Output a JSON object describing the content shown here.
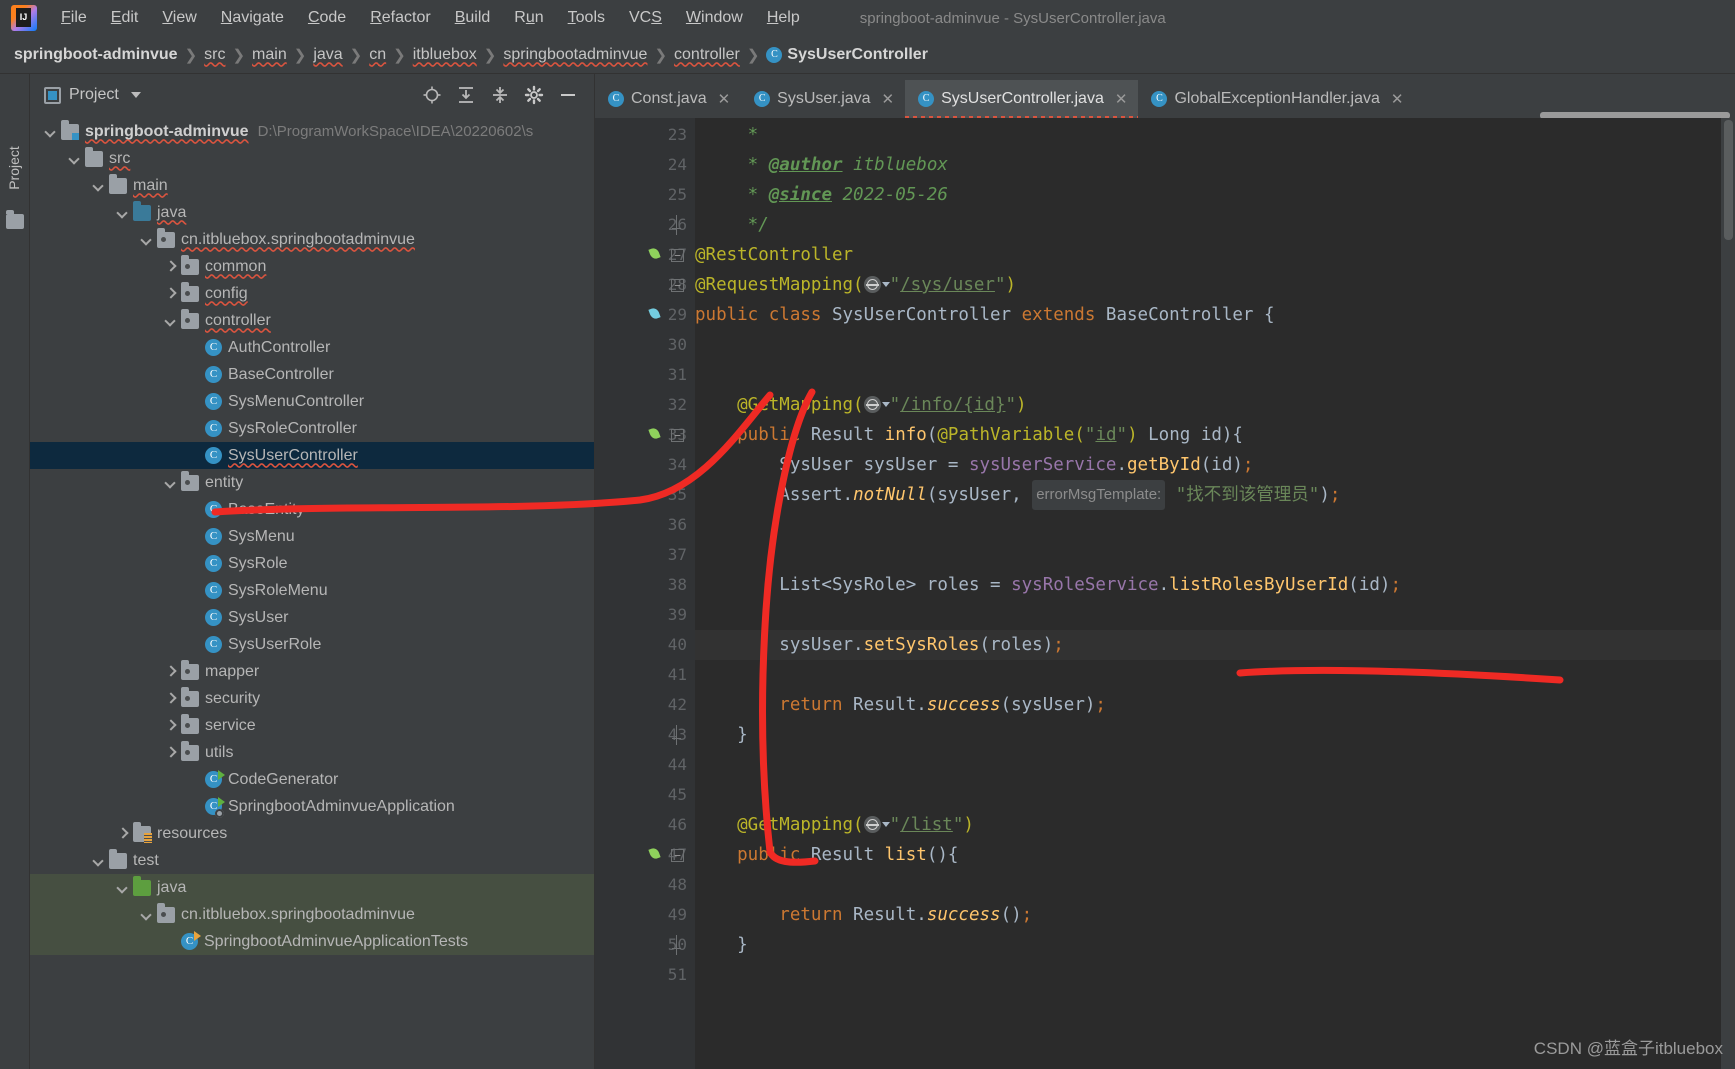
{
  "window": {
    "title": "springboot-adminvue - SysUserController.java",
    "logo_text": "IJ"
  },
  "menu": {
    "items": [
      {
        "mnemonic": "F",
        "rest": "ile"
      },
      {
        "mnemonic": "E",
        "rest": "dit"
      },
      {
        "mnemonic": "V",
        "rest": "iew"
      },
      {
        "mnemonic": "N",
        "rest": "avigate"
      },
      {
        "mnemonic": "C",
        "rest": "ode"
      },
      {
        "mnemonic": "R",
        "rest": "efactor"
      },
      {
        "mnemonic": "B",
        "rest": "uild"
      },
      {
        "mnemonic": "R",
        "rest": "un",
        "prefix": "R",
        "mid": "u",
        "tail": "n"
      },
      {
        "mnemonic": "T",
        "rest": "ools"
      },
      {
        "mnemonic": "S",
        "rest": "VCS"
      },
      {
        "mnemonic": "W",
        "rest": "indow"
      },
      {
        "mnemonic": "H",
        "rest": "elp"
      }
    ],
    "labels": [
      "File",
      "Edit",
      "View",
      "Navigate",
      "Code",
      "Refactor",
      "Build",
      "Run",
      "Tools",
      "VCS",
      "Window",
      "Help"
    ]
  },
  "breadcrumb": {
    "items": [
      "springboot-adminvue",
      "src",
      "main",
      "java",
      "cn",
      "itbluebox",
      "springbootadminvue",
      "controller"
    ],
    "last_class": "SysUserController",
    "class_icon": "C"
  },
  "toolwindow": {
    "vertical_tab": "Project",
    "panel_title": "Project",
    "actions": [
      "locate-icon",
      "expand-all-icon",
      "collapse-all-icon",
      "settings-icon",
      "hide-icon"
    ]
  },
  "tree": {
    "items": [
      {
        "label": "springboot-adminvue",
        "path": "D:\\ProgramWorkSpace\\IDEA\\20220602\\s",
        "indent": 0,
        "arrow": "down",
        "icon": "module",
        "bold": true,
        "squiggle": true,
        "selected": false
      },
      {
        "label": "src",
        "indent": 1,
        "arrow": "down",
        "icon": "folder",
        "squiggle": true
      },
      {
        "label": "main",
        "indent": 2,
        "arrow": "down",
        "icon": "folder",
        "squiggle": true
      },
      {
        "label": "java",
        "indent": 3,
        "arrow": "down",
        "icon": "folder-blue",
        "squiggle": true
      },
      {
        "label": "cn.itbluebox.springbootadminvue",
        "indent": 4,
        "arrow": "down",
        "icon": "package",
        "squiggle": true
      },
      {
        "label": "common",
        "indent": 5,
        "arrow": "right",
        "icon": "package",
        "squiggle": true
      },
      {
        "label": "config",
        "indent": 5,
        "arrow": "right",
        "icon": "package",
        "squiggle": true
      },
      {
        "label": "controller",
        "indent": 5,
        "arrow": "down",
        "icon": "package",
        "squiggle": true
      },
      {
        "label": "AuthController",
        "indent": 6,
        "arrow": "none",
        "icon": "class"
      },
      {
        "label": "BaseController",
        "indent": 6,
        "arrow": "none",
        "icon": "class"
      },
      {
        "label": "SysMenuController",
        "indent": 6,
        "arrow": "none",
        "icon": "class"
      },
      {
        "label": "SysRoleController",
        "indent": 6,
        "arrow": "none",
        "icon": "class"
      },
      {
        "label": "SysUserController",
        "indent": 6,
        "arrow": "none",
        "icon": "class",
        "selected": true,
        "squiggle": true
      },
      {
        "label": "entity",
        "indent": 5,
        "arrow": "down",
        "icon": "package"
      },
      {
        "label": "BaseEntity",
        "indent": 6,
        "arrow": "none",
        "icon": "class"
      },
      {
        "label": "SysMenu",
        "indent": 6,
        "arrow": "none",
        "icon": "class"
      },
      {
        "label": "SysRole",
        "indent": 6,
        "arrow": "none",
        "icon": "class"
      },
      {
        "label": "SysRoleMenu",
        "indent": 6,
        "arrow": "none",
        "icon": "class"
      },
      {
        "label": "SysUser",
        "indent": 6,
        "arrow": "none",
        "icon": "class"
      },
      {
        "label": "SysUserRole",
        "indent": 6,
        "arrow": "none",
        "icon": "class"
      },
      {
        "label": "mapper",
        "indent": 5,
        "arrow": "right",
        "icon": "package"
      },
      {
        "label": "security",
        "indent": 5,
        "arrow": "right",
        "icon": "package"
      },
      {
        "label": "service",
        "indent": 5,
        "arrow": "right",
        "icon": "package"
      },
      {
        "label": "utils",
        "indent": 5,
        "arrow": "right",
        "icon": "package"
      },
      {
        "label": "CodeGenerator",
        "indent": 6,
        "arrow": "none",
        "icon": "class-runnable"
      },
      {
        "label": "SpringbootAdminvueApplication",
        "indent": 6,
        "arrow": "none",
        "icon": "class-spring-runnable"
      },
      {
        "label": "resources",
        "indent": 3,
        "arrow": "right",
        "icon": "resources"
      },
      {
        "label": "test",
        "indent": 2,
        "arrow": "down",
        "icon": "folder"
      },
      {
        "label": "java",
        "indent": 3,
        "arrow": "down",
        "icon": "folder-green",
        "green": true
      },
      {
        "label": "cn.itbluebox.springbootadminvue",
        "indent": 4,
        "arrow": "down",
        "icon": "package",
        "green": true
      },
      {
        "label": "SpringbootAdminvueApplicationTests",
        "indent": 5,
        "arrow": "none",
        "icon": "class-test",
        "green": true
      }
    ]
  },
  "editor_tabs": [
    {
      "label": "Const.java",
      "icon": "C",
      "active": false
    },
    {
      "label": "SysUser.java",
      "icon": "C",
      "active": false
    },
    {
      "label": "SysUserController.java",
      "icon": "C",
      "active": true
    },
    {
      "label": "GlobalExceptionHandler.java",
      "icon": "C",
      "active": false
    }
  ],
  "code": {
    "first_line": 23,
    "lines": [
      {
        "n": 23,
        "gutter": "",
        "fold": "",
        "html": "<span class=\"c-cmt\">     *</span>"
      },
      {
        "n": 24,
        "gutter": "",
        "fold": "",
        "html": "<span class=\"c-cmt\">     * </span><span class=\"c-tag\">@author</span><span class=\"c-cmt\"> itbluebox</span>"
      },
      {
        "n": 25,
        "gutter": "",
        "fold": "",
        "html": "<span class=\"c-cmt\">     * </span><span class=\"c-tag\">@since</span><span class=\"c-cmt\"> 2022-05-26</span>"
      },
      {
        "n": 26,
        "gutter": "",
        "fold": "end",
        "html": "<span class=\"c-cmt\">     */</span>"
      },
      {
        "n": 27,
        "gutter": "spring-green",
        "fold": "minus",
        "html": "<span class=\"c-ann\">@RestController</span>"
      },
      {
        "n": 28,
        "gutter": "",
        "fold": "minus",
        "html": "<span class=\"c-ann\">@RequestMapping(</span>@GLOBE@<span class=\"c-str\">\"</span><span class=\"c-strlink\">/sys/user</span><span class=\"c-str\">\"</span><span class=\"c-ann\">)</span>"
      },
      {
        "n": 29,
        "gutter": "spring-bean",
        "fold": "",
        "html": "<span class=\"c-kw\">public class </span><span class=\"c-cls\">SysUserController </span><span class=\"c-kw\">extends </span><span class=\"c-cls\">BaseController </span><span class=\"c-pln\">{</span>"
      },
      {
        "n": 30,
        "gutter": "",
        "fold": "",
        "html": ""
      },
      {
        "n": 31,
        "gutter": "",
        "fold": "",
        "html": ""
      },
      {
        "n": 32,
        "gutter": "",
        "fold": "",
        "html": "<span class=\"c-ann\">    @GetMapping(</span>@GLOBE@<span class=\"c-str\">\"</span><span class=\"c-strlink\">/info/{id}</span><span class=\"c-str\">\"</span><span class=\"c-ann\">)</span>"
      },
      {
        "n": 33,
        "gutter": "spring-green",
        "fold": "minus",
        "html": "<span class=\"c-kw\">    public </span><span class=\"c-cls\">Result </span><span class=\"c-mth\">info</span><span class=\"c-pln\">(</span><span class=\"c-ann\">@PathVariable(</span><span class=\"c-str\">\"</span><span class=\"c-strlink\">id</span><span class=\"c-str\">\"</span><span class=\"c-ann\">) </span><span class=\"c-cls\">Long </span><span class=\"c-pln\">id){</span>"
      },
      {
        "n": 34,
        "gutter": "",
        "fold": "",
        "html": "<span class=\"c-cls\">        SysUser </span><span class=\"c-pln\">sysUser = </span><span class=\"c-fld\">sysUserService</span><span class=\"c-pln\">.</span><span class=\"c-mth\">getById</span><span class=\"c-pln\">(id)</span><span class=\"c-kw\">;</span>"
      },
      {
        "n": 35,
        "gutter": "",
        "fold": "",
        "html": "<span class=\"c-cls\">        Assert</span><span class=\"c-pln\">.</span><span class=\"c-mthstatic\">notNull</span><span class=\"c-pln\">(sysUser, </span><span class=\"hintchip\">errorMsgTemplate:</span><span class=\"c-str\"> \"找不到该管理员\"</span><span class=\"c-pln\">)</span><span class=\"c-kw\">;</span>"
      },
      {
        "n": 36,
        "gutter": "",
        "fold": "",
        "html": ""
      },
      {
        "n": 37,
        "gutter": "",
        "fold": "",
        "html": ""
      },
      {
        "n": 38,
        "gutter": "",
        "fold": "",
        "html": "<span class=\"c-cls\">        List&lt;SysRole&gt; </span><span class=\"c-pln\">roles = </span><span class=\"c-fld\">sysRoleService</span><span class=\"c-pln\">.</span><span class=\"c-mth\">listRolesByUserId</span><span class=\"c-pln\">(id)</span><span class=\"c-kw\">;</span>"
      },
      {
        "n": 39,
        "gutter": "",
        "fold": "",
        "html": ""
      },
      {
        "n": 40,
        "gutter": "",
        "fold": "",
        "highlight": true,
        "html": "<span class=\"c-pln\">        sysUser.</span><span class=\"c-mth\">setSysRoles</span><span class=\"c-pln\">(roles)</span><span class=\"c-kw\">;</span>"
      },
      {
        "n": 41,
        "gutter": "",
        "fold": "",
        "html": ""
      },
      {
        "n": 42,
        "gutter": "",
        "fold": "",
        "html": "<span class=\"c-kw\">        return </span><span class=\"c-cls\">Result</span><span class=\"c-pln\">.</span><span class=\"c-mthstatic\">success</span><span class=\"c-pln\">(sysUser)</span><span class=\"c-kw\">;</span>"
      },
      {
        "n": 43,
        "gutter": "",
        "fold": "end",
        "html": "<span class=\"c-pln\">    }</span>"
      },
      {
        "n": 44,
        "gutter": "",
        "fold": "",
        "html": ""
      },
      {
        "n": 45,
        "gutter": "",
        "fold": "",
        "html": ""
      },
      {
        "n": 46,
        "gutter": "",
        "fold": "",
        "html": "<span class=\"c-ann\">    @GetMapping(</span>@GLOBE@<span class=\"c-str\">\"</span><span class=\"c-strlink\">/list</span><span class=\"c-str\">\"</span><span class=\"c-ann\">)</span>"
      },
      {
        "n": 47,
        "gutter": "spring-green",
        "fold": "minus",
        "html": "<span class=\"c-kw\">    public </span><span class=\"c-cls\">Result </span><span class=\"c-mth\">list</span><span class=\"c-pln\">(){</span>"
      },
      {
        "n": 48,
        "gutter": "",
        "fold": "",
        "html": ""
      },
      {
        "n": 49,
        "gutter": "",
        "fold": "",
        "html": "<span class=\"c-kw\">        return </span><span class=\"c-cls\">Result</span><span class=\"c-pln\">.</span><span class=\"c-mthstatic\">success</span><span class=\"c-pln\">()</span><span class=\"c-kw\">;</span>"
      },
      {
        "n": 50,
        "gutter": "",
        "fold": "end",
        "html": "<span class=\"c-pln\">    }</span>"
      },
      {
        "n": 51,
        "gutter": "",
        "fold": "",
        "html": ""
      }
    ]
  },
  "annotations": {
    "color": "#ef2a24",
    "strokes": [
      "tree-to-method-arrow",
      "underline-list-roles-by-user-id",
      "bracket-method-body"
    ]
  },
  "watermark": "CSDN @蓝盒子itbluebox"
}
